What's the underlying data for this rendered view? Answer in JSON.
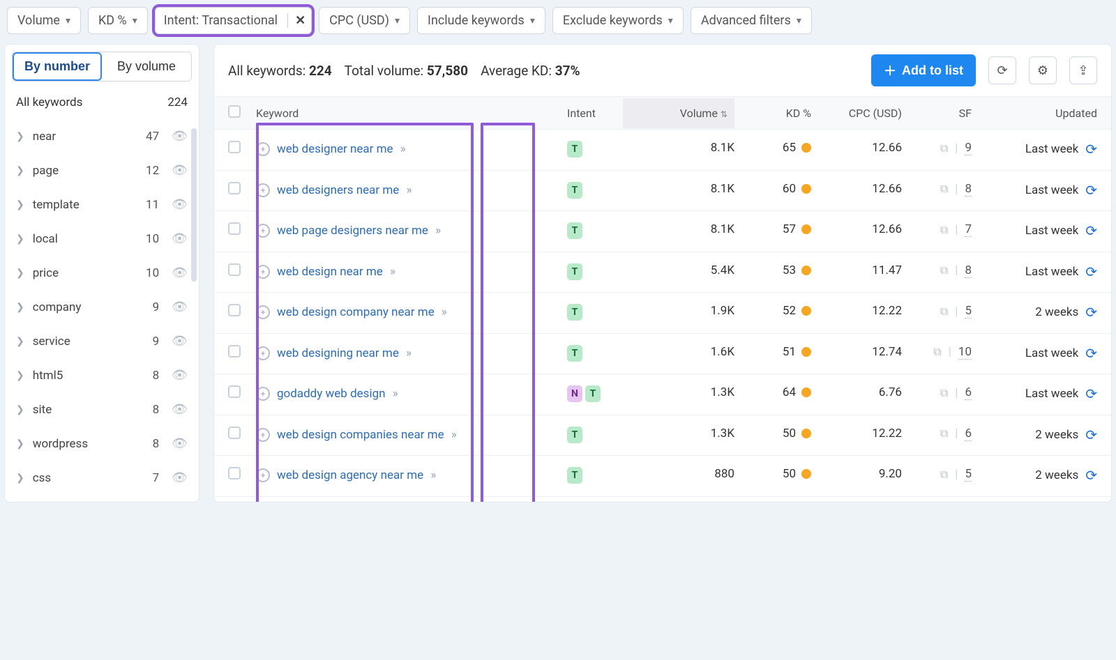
{
  "filters": {
    "volume": "Volume",
    "kd": "KD %",
    "intent": "Intent: Transactional",
    "cpc": "CPC (USD)",
    "include": "Include keywords",
    "exclude": "Exclude keywords",
    "advanced": "Advanced filters"
  },
  "toggle": {
    "by_number": "By number",
    "by_volume": "By volume"
  },
  "side": {
    "all_label": "All keywords",
    "all_count": "224",
    "items": [
      {
        "name": "near",
        "count": "47"
      },
      {
        "name": "page",
        "count": "12"
      },
      {
        "name": "template",
        "count": "11"
      },
      {
        "name": "local",
        "count": "10"
      },
      {
        "name": "price",
        "count": "10"
      },
      {
        "name": "company",
        "count": "9"
      },
      {
        "name": "service",
        "count": "9"
      },
      {
        "name": "html5",
        "count": "8"
      },
      {
        "name": "site",
        "count": "8"
      },
      {
        "name": "wordpress",
        "count": "8"
      },
      {
        "name": "css",
        "count": "7"
      }
    ]
  },
  "summary": {
    "all_keywords_label": "All keywords:",
    "all_keywords_value": "224",
    "total_volume_label": "Total volume:",
    "total_volume_value": "57,580",
    "avg_kd_label": "Average KD:",
    "avg_kd_value": "37%",
    "add_to_list": "Add to list"
  },
  "columns": {
    "keyword": "Keyword",
    "intent": "Intent",
    "volume": "Volume",
    "kd": "KD %",
    "cpc": "CPC (USD)",
    "sf": "SF",
    "updated": "Updated"
  },
  "rows": [
    {
      "keyword": "web designer near me",
      "intents": [
        "T"
      ],
      "volume": "8.1K",
      "kd": "65",
      "cpc": "12.66",
      "sf": "9",
      "updated": "Last week"
    },
    {
      "keyword": "web designers near me",
      "intents": [
        "T"
      ],
      "volume": "8.1K",
      "kd": "60",
      "cpc": "12.66",
      "sf": "8",
      "updated": "Last week"
    },
    {
      "keyword": "web page designers near me",
      "intents": [
        "T"
      ],
      "volume": "8.1K",
      "kd": "57",
      "cpc": "12.66",
      "sf": "7",
      "updated": "Last week"
    },
    {
      "keyword": "web design near me",
      "intents": [
        "T"
      ],
      "volume": "5.4K",
      "kd": "53",
      "cpc": "11.47",
      "sf": "8",
      "updated": "Last week"
    },
    {
      "keyword": "web design company near me",
      "intents": [
        "T"
      ],
      "volume": "1.9K",
      "kd": "52",
      "cpc": "12.22",
      "sf": "5",
      "updated": "2 weeks"
    },
    {
      "keyword": "web designing near me",
      "intents": [
        "T"
      ],
      "volume": "1.6K",
      "kd": "51",
      "cpc": "12.74",
      "sf": "10",
      "updated": "Last week"
    },
    {
      "keyword": "godaddy web design",
      "intents": [
        "N",
        "T"
      ],
      "volume": "1.3K",
      "kd": "64",
      "cpc": "6.76",
      "sf": "6",
      "updated": "Last week"
    },
    {
      "keyword": "web design companies near me",
      "intents": [
        "T"
      ],
      "volume": "1.3K",
      "kd": "50",
      "cpc": "12.22",
      "sf": "6",
      "updated": "2 weeks"
    },
    {
      "keyword": "web design agency near me",
      "intents": [
        "T"
      ],
      "volume": "880",
      "kd": "50",
      "cpc": "9.20",
      "sf": "5",
      "updated": "2 weeks"
    }
  ]
}
